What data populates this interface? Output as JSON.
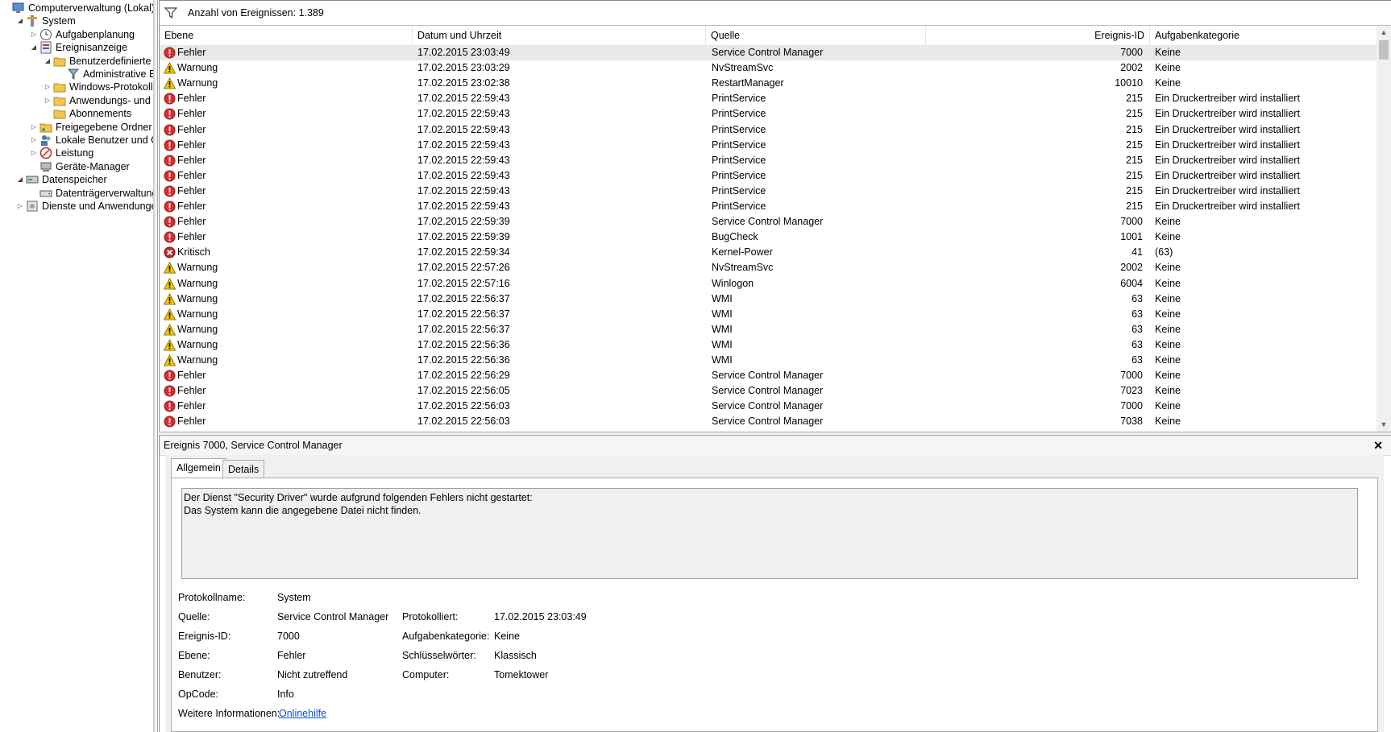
{
  "tree": {
    "items": [
      {
        "label": "Computerverwaltung (Lokal)",
        "icon": "computer-management-icon",
        "indent": 0,
        "expander": ""
      },
      {
        "label": "System",
        "icon": "tools-icon",
        "indent": 1,
        "expander": "◢"
      },
      {
        "label": "Aufgabenplanung",
        "icon": "clock-icon",
        "indent": 2,
        "expander": "▷"
      },
      {
        "label": "Ereignisanzeige",
        "icon": "event-viewer-icon",
        "indent": 2,
        "expander": "◢"
      },
      {
        "label": "Benutzerdefinierte A",
        "icon": "folder-icon",
        "indent": 3,
        "expander": "◢"
      },
      {
        "label": "Administrative E",
        "icon": "filter-icon",
        "indent": 4,
        "expander": ""
      },
      {
        "label": "Windows-Protokolle",
        "icon": "folder-icon",
        "indent": 3,
        "expander": "▷"
      },
      {
        "label": "Anwendungs- und D",
        "icon": "folder-icon",
        "indent": 3,
        "expander": "▷"
      },
      {
        "label": "Abonnements",
        "icon": "folder-icon",
        "indent": 3,
        "expander": ""
      },
      {
        "label": "Freigegebene Ordner",
        "icon": "shared-folder-icon",
        "indent": 2,
        "expander": "▷"
      },
      {
        "label": "Lokale Benutzer und Gr",
        "icon": "users-icon",
        "indent": 2,
        "expander": "▷"
      },
      {
        "label": "Leistung",
        "icon": "performance-icon",
        "indent": 2,
        "expander": "▷"
      },
      {
        "label": "Geräte-Manager",
        "icon": "device-manager-icon",
        "indent": 2,
        "expander": ""
      },
      {
        "label": "Datenspeicher",
        "icon": "storage-icon",
        "indent": 1,
        "expander": "◢"
      },
      {
        "label": "Datenträgerverwaltung",
        "icon": "disk-management-icon",
        "indent": 2,
        "expander": ""
      },
      {
        "label": "Dienste und Anwendungen",
        "icon": "services-icon",
        "indent": 1,
        "expander": "▷"
      }
    ]
  },
  "list": {
    "filter_text": "Anzahl von Ereignissen: 1.389",
    "columns": {
      "level": "Ebene",
      "date": "Datum und Uhrzeit",
      "source": "Quelle",
      "id": "Ereignis-ID",
      "category": "Aufgabenkategorie"
    },
    "rows": [
      {
        "level": "Fehler",
        "type": "error",
        "date": "17.02.2015 23:03:49",
        "source": "Service Control Manager",
        "id": "7000",
        "category": "Keine"
      },
      {
        "level": "Warnung",
        "type": "warning",
        "date": "17.02.2015 23:03:29",
        "source": "NvStreamSvc",
        "id": "2002",
        "category": "Keine"
      },
      {
        "level": "Warnung",
        "type": "warning",
        "date": "17.02.2015 23:02:38",
        "source": "RestartManager",
        "id": "10010",
        "category": "Keine"
      },
      {
        "level": "Fehler",
        "type": "error",
        "date": "17.02.2015 22:59:43",
        "source": "PrintService",
        "id": "215",
        "category": "Ein Druckertreiber wird installiert"
      },
      {
        "level": "Fehler",
        "type": "error",
        "date": "17.02.2015 22:59:43",
        "source": "PrintService",
        "id": "215",
        "category": "Ein Druckertreiber wird installiert"
      },
      {
        "level": "Fehler",
        "type": "error",
        "date": "17.02.2015 22:59:43",
        "source": "PrintService",
        "id": "215",
        "category": "Ein Druckertreiber wird installiert"
      },
      {
        "level": "Fehler",
        "type": "error",
        "date": "17.02.2015 22:59:43",
        "source": "PrintService",
        "id": "215",
        "category": "Ein Druckertreiber wird installiert"
      },
      {
        "level": "Fehler",
        "type": "error",
        "date": "17.02.2015 22:59:43",
        "source": "PrintService",
        "id": "215",
        "category": "Ein Druckertreiber wird installiert"
      },
      {
        "level": "Fehler",
        "type": "error",
        "date": "17.02.2015 22:59:43",
        "source": "PrintService",
        "id": "215",
        "category": "Ein Druckertreiber wird installiert"
      },
      {
        "level": "Fehler",
        "type": "error",
        "date": "17.02.2015 22:59:43",
        "source": "PrintService",
        "id": "215",
        "category": "Ein Druckertreiber wird installiert"
      },
      {
        "level": "Fehler",
        "type": "error",
        "date": "17.02.2015 22:59:43",
        "source": "PrintService",
        "id": "215",
        "category": "Ein Druckertreiber wird installiert"
      },
      {
        "level": "Fehler",
        "type": "error",
        "date": "17.02.2015 22:59:39",
        "source": "Service Control Manager",
        "id": "7000",
        "category": "Keine"
      },
      {
        "level": "Fehler",
        "type": "error",
        "date": "17.02.2015 22:59:39",
        "source": "BugCheck",
        "id": "1001",
        "category": "Keine"
      },
      {
        "level": "Kritisch",
        "type": "critical",
        "date": "17.02.2015 22:59:34",
        "source": "Kernel-Power",
        "id": "41",
        "category": "(63)"
      },
      {
        "level": "Warnung",
        "type": "warning",
        "date": "17.02.2015 22:57:26",
        "source": "NvStreamSvc",
        "id": "2002",
        "category": "Keine"
      },
      {
        "level": "Warnung",
        "type": "warning",
        "date": "17.02.2015 22:57:16",
        "source": "Winlogon",
        "id": "6004",
        "category": "Keine"
      },
      {
        "level": "Warnung",
        "type": "warning",
        "date": "17.02.2015 22:56:37",
        "source": "WMI",
        "id": "63",
        "category": "Keine"
      },
      {
        "level": "Warnung",
        "type": "warning",
        "date": "17.02.2015 22:56:37",
        "source": "WMI",
        "id": "63",
        "category": "Keine"
      },
      {
        "level": "Warnung",
        "type": "warning",
        "date": "17.02.2015 22:56:37",
        "source": "WMI",
        "id": "63",
        "category": "Keine"
      },
      {
        "level": "Warnung",
        "type": "warning",
        "date": "17.02.2015 22:56:36",
        "source": "WMI",
        "id": "63",
        "category": "Keine"
      },
      {
        "level": "Warnung",
        "type": "warning",
        "date": "17.02.2015 22:56:36",
        "source": "WMI",
        "id": "63",
        "category": "Keine"
      },
      {
        "level": "Fehler",
        "type": "error",
        "date": "17.02.2015 22:56:29",
        "source": "Service Control Manager",
        "id": "7000",
        "category": "Keine"
      },
      {
        "level": "Fehler",
        "type": "error",
        "date": "17.02.2015 22:56:05",
        "source": "Service Control Manager",
        "id": "7023",
        "category": "Keine"
      },
      {
        "level": "Fehler",
        "type": "error",
        "date": "17.02.2015 22:56:03",
        "source": "Service Control Manager",
        "id": "7000",
        "category": "Keine"
      },
      {
        "level": "Fehler",
        "type": "error",
        "date": "17.02.2015 22:56:03",
        "source": "Service Control Manager",
        "id": "7038",
        "category": "Keine"
      }
    ]
  },
  "details": {
    "title": "Ereignis 7000, Service Control Manager",
    "close_glyph": "✕",
    "tabs": [
      "Allgemein",
      "Details"
    ],
    "message_line1": "Der Dienst \"Security Driver\" wurde aufgrund folgenden Fehlers nicht gestartet:",
    "message_line2": "Das System kann die angegebene Datei nicht finden.",
    "props": {
      "log_label": "Protokollname:",
      "log_value": "System",
      "source_label": "Quelle:",
      "source_value": "Service Control Manager",
      "logged_label": "Protokolliert:",
      "logged_value": "17.02.2015 23:03:49",
      "id_label": "Ereignis-ID:",
      "id_value": "7000",
      "category_label": "Aufgabenkategorie:",
      "category_value": "Keine",
      "level_label": "Ebene:",
      "level_value": "Fehler",
      "keywords_label": "Schlüsselwörter:",
      "keywords_value": "Klassisch",
      "user_label": "Benutzer:",
      "user_value": "Nicht zutreffend",
      "computer_label": "Computer:",
      "computer_value": "Tomektower",
      "opcode_label": "OpCode:",
      "opcode_value": "Info",
      "more_label": "Weitere Informationen:",
      "more_link": "Onlinehilfe"
    }
  },
  "colors": {
    "error": "#d32f2f",
    "warning": "#f5c400",
    "critical": "#c62828",
    "link": "#0b4ecf",
    "selection": "#e8e8e8"
  }
}
